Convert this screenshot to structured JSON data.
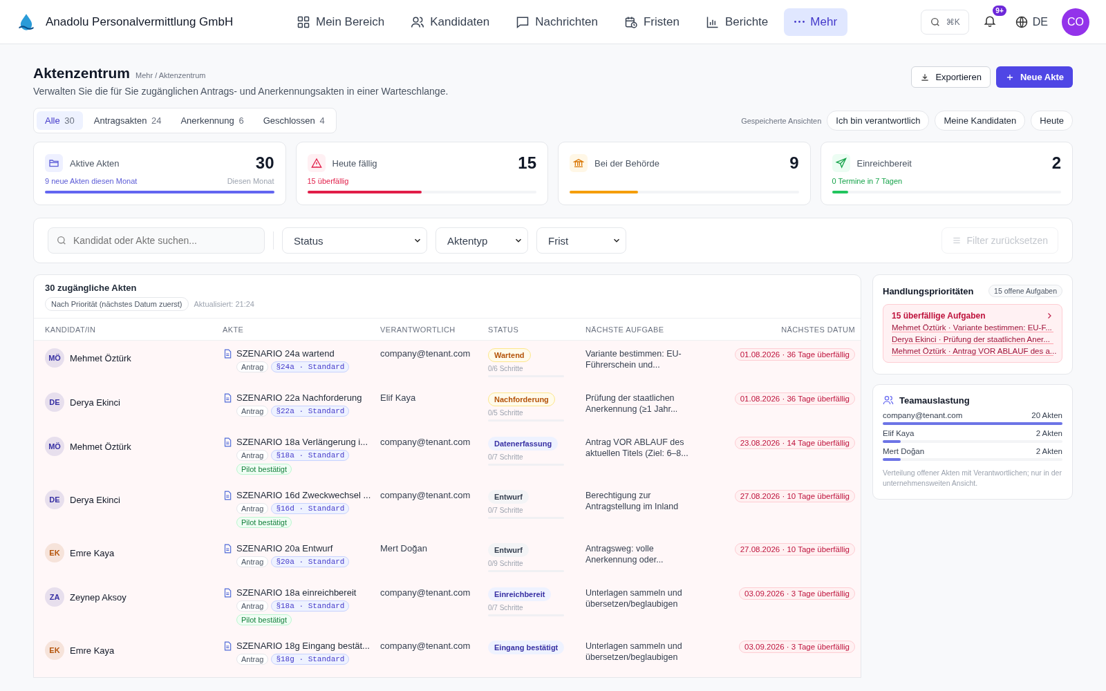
{
  "brand": {
    "name": "Anadolu Personalvermittlung GmbH"
  },
  "nav": [
    {
      "label": "Mein Bereich",
      "selected": false
    },
    {
      "label": "Kandidaten",
      "selected": false
    },
    {
      "label": "Nachrichten",
      "selected": false
    },
    {
      "label": "Fristen",
      "selected": false
    },
    {
      "label": "Berichte",
      "selected": false
    },
    {
      "label": "Mehr",
      "selected": true
    }
  ],
  "header_tools": {
    "search_shortcut": "⌘K",
    "notification_badge": "9+",
    "language": "DE",
    "avatar": "CO"
  },
  "page": {
    "title": "Aktenzentrum",
    "breadcrumb": "Mehr / Aktenzentrum",
    "subtitle": "Verwalten Sie die für Sie zugänglichen Antrags- und Anerkennungsakten in einer Warteschlange.",
    "actions": [
      {
        "label": "Exportieren",
        "kind": "secondary"
      },
      {
        "label": "Neue Akte",
        "kind": "primary"
      }
    ]
  },
  "tabs": [
    {
      "label": "Alle",
      "count": "30",
      "selected": true
    },
    {
      "label": "Antragsakten",
      "count": "24",
      "selected": false
    },
    {
      "label": "Anerkennung",
      "count": "6",
      "selected": false
    },
    {
      "label": "Geschlossen",
      "count": "4",
      "selected": false
    }
  ],
  "saved_views": {
    "label": "Gespeicherte Ansichten",
    "items": [
      "Ich bin verantwortlich",
      "Meine Kandidaten",
      "Heute"
    ]
  },
  "kpis": [
    {
      "label": "Aktive Akten",
      "value": "30",
      "note": "9 neue Akten diesen Monat",
      "note_right": "Diesen Monat",
      "level": 1
    },
    {
      "label": "Heute fällig",
      "value": "15",
      "note": "15 überfällig",
      "level": 0.5
    },
    {
      "label": "Bei der Behörde",
      "value": "9",
      "level": 0.3
    },
    {
      "label": "Einreichbereit",
      "value": "2",
      "note": "0 Termine in 7 Tagen",
      "level": 0.07
    }
  ],
  "filters": {
    "search_placeholder": "Kandidat oder Akte suchen...",
    "dropdowns": [
      "Status",
      "Aktentyp",
      "Frist"
    ],
    "reset": {
      "label": "Filter zurücksetzen",
      "disabled": true
    }
  },
  "table": {
    "title": "30 zugängliche Akten",
    "sort": "Nach Priorität (nächstes Datum zuerst)",
    "updated": "Aktualisiert: 21:24",
    "columns": [
      "KANDIDAT/IN",
      "AKTE",
      "VERANTWORTLICH",
      "STATUS",
      "NÄCHSTE AUFGABE",
      "NÄCHSTES DATUM"
    ],
    "rows": [
      {
        "initials": "MÖ",
        "color": "#3730a3",
        "candidate": "Mehmet Öztürk",
        "file": "SZENARIO 24a wartend",
        "type": "Antrag",
        "code": "§24a · Standard",
        "owner": "company@tenant.com",
        "status": "Wartend",
        "kind": "warning",
        "steps": "0/6 Schritte",
        "task": "Variante bestimmen: EU-Führerschein und...",
        "date": "01.08.2026 · 36 Tage überfällig"
      },
      {
        "initials": "DE",
        "color": "#3730a3",
        "candidate": "Derya Ekinci",
        "file": "SZENARIO 22a Nachforderung",
        "type": "Antrag",
        "code": "§22a · Standard",
        "owner": "Elif Kaya",
        "status": "Nachforderung",
        "kind": "warning",
        "steps": "0/5 Schritte",
        "task": "Prüfung der staatlichen Anerkennung (≥1 Jahr...",
        "date": "01.08.2026 · 36 Tage überfällig"
      },
      {
        "initials": "MÖ",
        "color": "#3730a3",
        "candidate": "Mehmet Öztürk",
        "file": "SZENARIO 18a Verlängerung i...",
        "type": "Antrag",
        "code": "§18a · Standard",
        "pilot": "Pilot bestätigt",
        "owner": "company@tenant.com",
        "status": "Datenerfassung",
        "kind": "info",
        "steps": "0/7 Schritte",
        "task": "Antrag VOR ABLAUF des aktuellen Titels (Ziel: 6–8...",
        "date": "23.08.2026 · 14 Tage überfällig"
      },
      {
        "initials": "DE",
        "color": "#3730a3",
        "candidate": "Derya Ekinci",
        "file": "SZENARIO 16d Zweckwechsel ...",
        "type": "Antrag",
        "code": "§16d · Standard",
        "pilot": "Pilot bestätigt",
        "owner": "company@tenant.com",
        "status": "Entwurf",
        "kind": "neutral",
        "steps": "0/7 Schritte",
        "task": "Berechtigung zur Antragstellung im Inland",
        "date": "27.08.2026 · 10 Tage überfällig"
      },
      {
        "initials": "EK",
        "color": "#b45309",
        "candidate": "Emre Kaya",
        "file": "SZENARIO 20a Entwurf",
        "type": "Antrag",
        "code": "§20a · Standard",
        "owner": "Mert Doğan",
        "status": "Entwurf",
        "kind": "neutral",
        "steps": "0/9 Schritte",
        "task": "Antragsweg: volle Anerkennung oder...",
        "date": "27.08.2026 · 10 Tage überfällig"
      },
      {
        "initials": "ZA",
        "color": "#3730a3",
        "candidate": "Zeynep Aksoy",
        "file": "SZENARIO 18a einreichbereit",
        "type": "Antrag",
        "code": "§18a · Standard",
        "pilot": "Pilot bestätigt",
        "owner": "company@tenant.com",
        "status": "Einreichbereit",
        "kind": "info",
        "steps": "0/7 Schritte",
        "task": "Unterlagen sammeln und übersetzen/beglaubigen",
        "date": "03.09.2026 · 3 Tage überfällig"
      },
      {
        "initials": "EK",
        "color": "#b45309",
        "candidate": "Emre Kaya",
        "file": "SZENARIO 18g Eingang bestät...",
        "type": "Antrag",
        "code": "§18g · Standard",
        "owner": "company@tenant.com",
        "status": "Eingang bestätigt",
        "kind": "info",
        "task": "Unterlagen sammeln und übersetzen/beglaubigen",
        "date": "03.09.2026 · 3 Tage überfällig"
      }
    ]
  },
  "priorities": {
    "title": "Handlungsprioritäten",
    "badge": "15 offene Aufgaben",
    "alert_title": "15 überfällige Aufgaben",
    "items": [
      "Mehmet Öztürk · Variante bestimmen: EU-F...",
      "Derya Ekinci · Prüfung der staatlichen Aner...",
      "Mehmet Öztürk · Antrag VOR ABLAUF des a..."
    ]
  },
  "team": {
    "title": "Teamauslastung",
    "members": [
      {
        "name": "company@tenant.com",
        "count": "20 Akten",
        "level": 1
      },
      {
        "name": "Elif Kaya",
        "count": "2 Akten",
        "level": 0.1
      },
      {
        "name": "Mert Doğan",
        "count": "2 Akten",
        "level": 0.1
      }
    ],
    "note": "Verteilung offener Akten mit Verantwortlichen; nur in der unternehmensweiten Ansicht."
  }
}
